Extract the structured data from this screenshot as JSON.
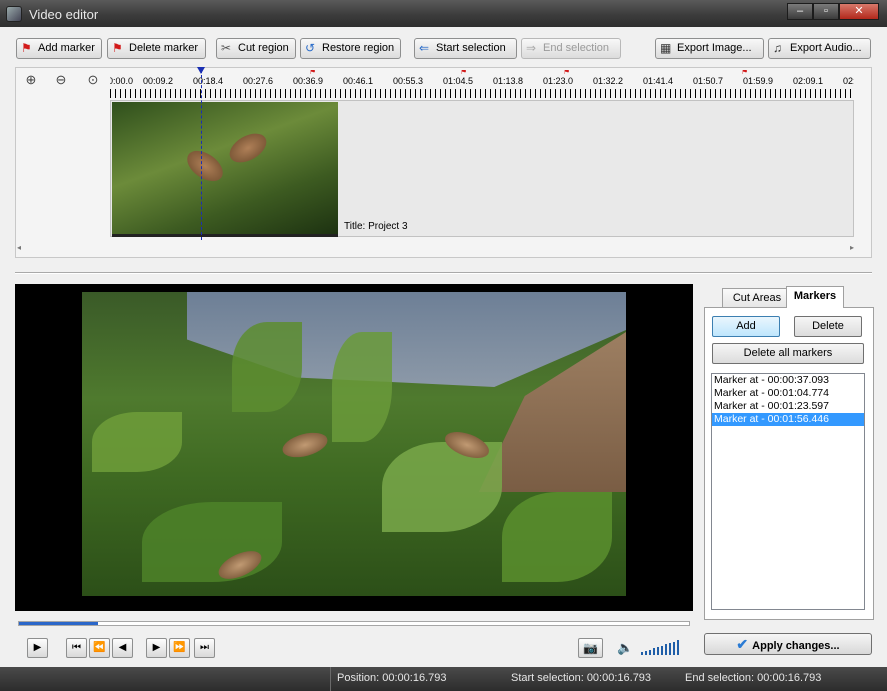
{
  "window": {
    "title": "Video editor",
    "controls": [
      "‒",
      "▫",
      "✕"
    ]
  },
  "toolbar": {
    "add_marker": "Add marker",
    "delete_marker": "Delete marker",
    "cut_region": "Cut region",
    "restore_region": "Restore region",
    "start_selection": "Start selection",
    "end_selection": "End selection",
    "export_image": "Export Image...",
    "export_audio": "Export Audio..."
  },
  "timeline": {
    "ruler_labels": [
      "0:00.0",
      "00:09.2",
      "00:18.4",
      "00:27.6",
      "00:36.9",
      "00:46.1",
      "00:55.3",
      "01:04.5",
      "01:13.8",
      "01:23.0",
      "01:32.2",
      "01:41.4",
      "01:50.7",
      "01:59.9",
      "02:09.1",
      "02:"
    ],
    "clip_title": "Title: Project 3"
  },
  "tabs": {
    "cut_areas": "Cut Areas",
    "markers": "Markers"
  },
  "markers_panel": {
    "add": "Add",
    "delete": "Delete",
    "delete_all": "Delete all markers",
    "items": [
      "Marker at - 00:00:37.093",
      "Marker at - 00:01:04.774",
      "Marker at - 00:01:23.597",
      "Marker at - 00:01:56.446"
    ],
    "selected_index": 3
  },
  "player": {
    "progress_fraction": 0.118,
    "play": "▶",
    "first": "⏮",
    "rewind": "⏪",
    "prev": "◀",
    "next": "▶",
    "forward": "⏩",
    "last": "⏭",
    "snapshot_icon": "camera-icon",
    "volume_icon": "speaker-icon"
  },
  "apply_button": "Apply changes...",
  "status": {
    "position": "Position: 00:00:16.793",
    "start_selection": "Start selection: 00:00:16.793",
    "end_selection": "End selection: 00:00:16.793"
  },
  "colors": {
    "accent": "#1a2fb3",
    "selection": "#3399ff",
    "marker_flag": "#d21a1a"
  }
}
